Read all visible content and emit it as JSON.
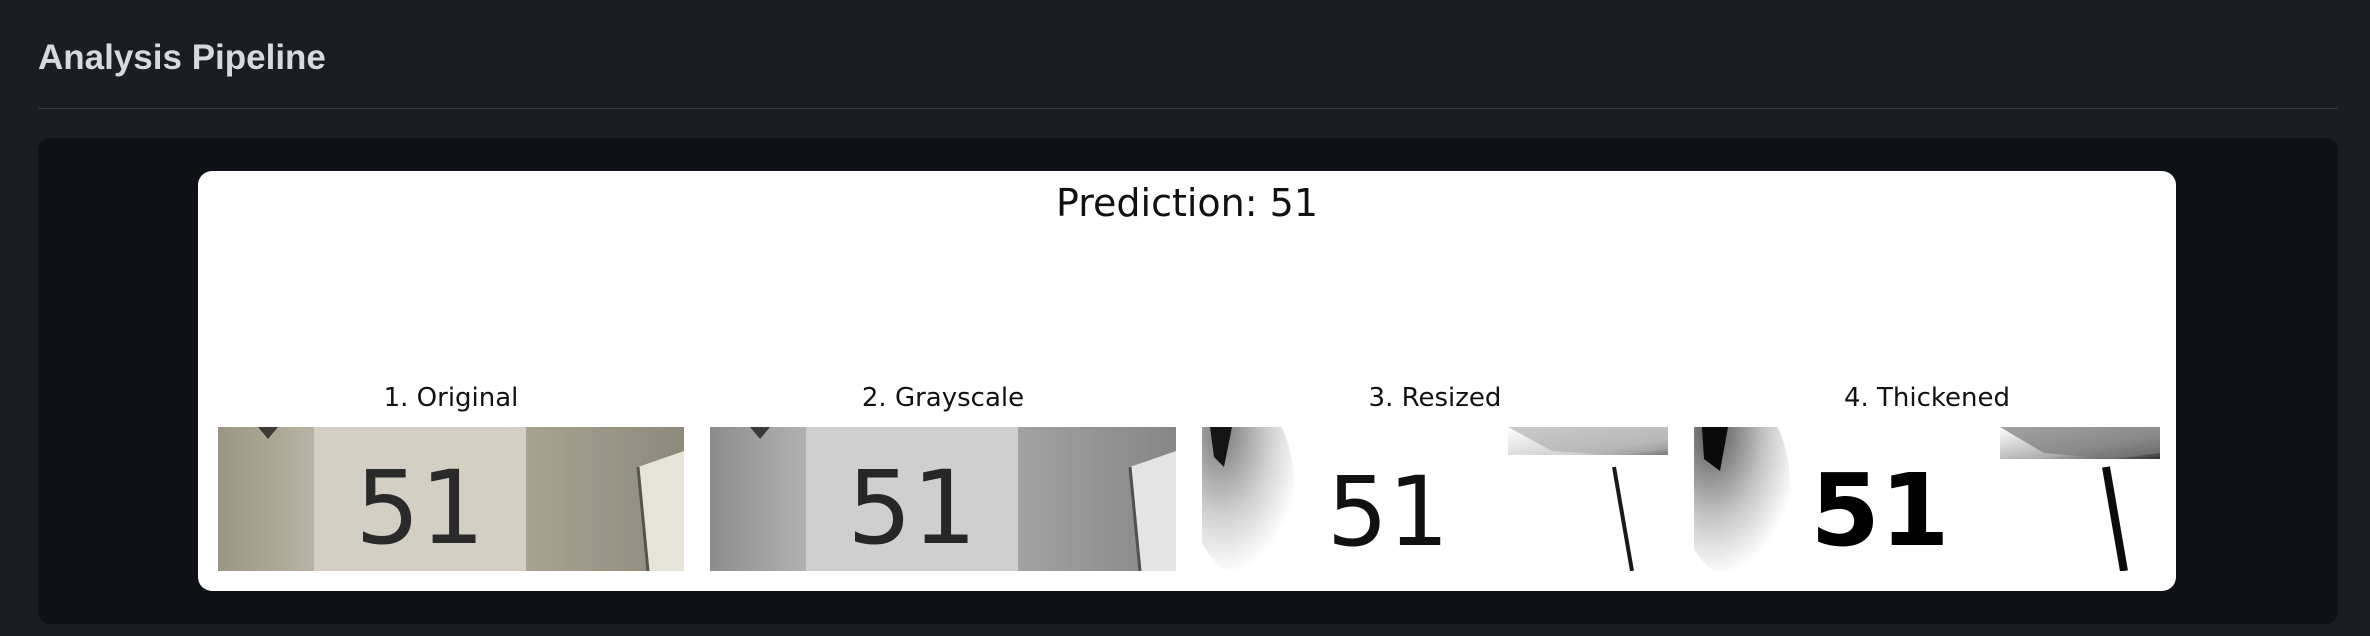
{
  "section": {
    "title": "Analysis Pipeline"
  },
  "figure": {
    "title": "Prediction: 51",
    "panels": [
      {
        "label": "1. Original",
        "style": "color"
      },
      {
        "label": "2. Grayscale",
        "style": "gray"
      },
      {
        "label": "3. Resized",
        "style": "binary-thin"
      },
      {
        "label": "4. Thickened",
        "style": "binary-thick"
      }
    ],
    "digit_text": "51"
  },
  "colors": {
    "page_bg": "#1a1d24",
    "panel_bg": "#0e1115",
    "figure_bg": "#ffffff",
    "heading": "#d6d9de"
  }
}
